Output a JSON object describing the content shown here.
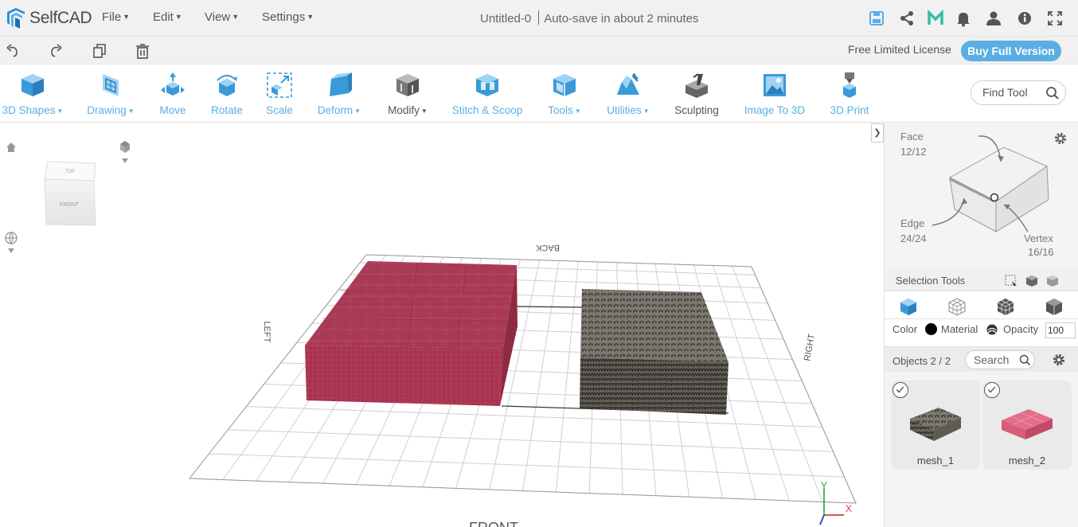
{
  "app": {
    "name": "SelfCAD"
  },
  "menus": [
    {
      "label": "File"
    },
    {
      "label": "Edit"
    },
    {
      "label": "View"
    },
    {
      "label": "Settings"
    }
  ],
  "document": {
    "title": "Untitled-0",
    "autosave": "Auto-save in about 2 minutes"
  },
  "topbar_icons": [
    "save-icon",
    "share-icon",
    "m-icon",
    "bell-icon",
    "user-icon",
    "info-icon",
    "fullscreen-icon"
  ],
  "bar2": {
    "icons": [
      "undo-icon",
      "redo-icon",
      "copy-icon",
      "delete-icon"
    ],
    "license_text": "Free Limited License",
    "buy_label": "Buy Full Version"
  },
  "toolbar": {
    "tools": [
      {
        "label": "3D Shapes",
        "dropdown": true,
        "icon": "cube-icon"
      },
      {
        "label": "Drawing",
        "dropdown": true,
        "icon": "drawing-icon"
      },
      {
        "label": "Move",
        "dropdown": false,
        "icon": "move-icon"
      },
      {
        "label": "Rotate",
        "dropdown": false,
        "icon": "rotate-icon"
      },
      {
        "label": "Scale",
        "dropdown": false,
        "icon": "scale-icon"
      },
      {
        "label": "Deform",
        "dropdown": true,
        "icon": "deform-icon"
      },
      {
        "label": "Modify",
        "dropdown": true,
        "icon": "modify-icon"
      },
      {
        "label": "Stitch & Scoop",
        "dropdown": false,
        "icon": "stitch-icon"
      },
      {
        "label": "Tools",
        "dropdown": true,
        "icon": "tools-icon"
      },
      {
        "label": "Utilities",
        "dropdown": true,
        "icon": "utilities-icon"
      },
      {
        "label": "Sculpting",
        "dropdown": false,
        "icon": "sculpting-icon"
      },
      {
        "label": "Image To 3D",
        "dropdown": false,
        "icon": "image-icon"
      },
      {
        "label": "3D Print",
        "dropdown": false,
        "icon": "print-icon"
      }
    ],
    "find_placeholder": "Find Tool"
  },
  "viewport": {
    "viewcube_top": "TOP",
    "viewcube_front": "FRONT",
    "grid_labels": {
      "back": "BACK",
      "left": "LEFT",
      "right": "RIGHT",
      "front": "FRONT"
    },
    "axis": {
      "y": "Y",
      "x": "X"
    },
    "colors": {
      "mesh_pink": "#b03a57",
      "mesh_gray": "#7f7a72",
      "axis_y": "#2a9d4a",
      "axis_x": "#d43b3b",
      "axis_z": "#3050d0"
    }
  },
  "right_panel": {
    "face_label": "Face",
    "face_count": "12/12",
    "edge_label": "Edge",
    "edge_count": "24/24",
    "vertex_label": "Vertex",
    "vertex_count": "16/16",
    "selection_tools_label": "Selection Tools",
    "color_label": "Color",
    "color_value": "#000000",
    "material_label": "Material",
    "opacity_label": "Opacity",
    "opacity_value": "100",
    "objects_label": "Objects 2 / 2",
    "search_placeholder": "Search",
    "objects": [
      {
        "name": "mesh_1",
        "checked": true
      },
      {
        "name": "mesh_2",
        "checked": true
      }
    ]
  }
}
